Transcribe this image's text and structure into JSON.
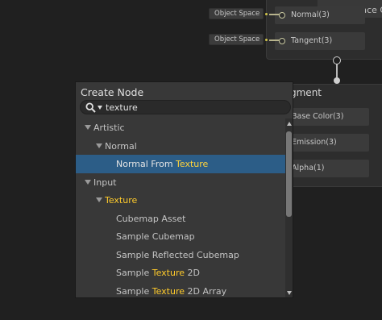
{
  "graph": {
    "master_node": {
      "title": "Surface O",
      "ports": [
        {
          "label": "Normal(3)",
          "input": "Object Space"
        },
        {
          "label": "Tangent(3)",
          "input": "Object Space"
        }
      ]
    },
    "fragment": {
      "title": "gment",
      "ports": [
        "Base Color(3)",
        "Emission(3)",
        "Alpha(1)"
      ]
    }
  },
  "create_node": {
    "title": "Create Node",
    "search": {
      "value": "texture",
      "query_highlight": "Texture"
    },
    "items": [
      {
        "label": "Artistic",
        "type": "category",
        "level": 0,
        "expanded": true
      },
      {
        "label": "Normal",
        "type": "category",
        "level": 1,
        "expanded": true
      },
      {
        "pre": "Normal From ",
        "match": "Texture",
        "post": "",
        "type": "node",
        "level": 2,
        "selected": true
      },
      {
        "label": "Input",
        "type": "category",
        "level": 0,
        "expanded": true
      },
      {
        "pre": "",
        "match": "Texture",
        "post": "",
        "type": "category",
        "level": 1,
        "expanded": true
      },
      {
        "pre": "Cubemap Asset",
        "match": "",
        "post": "",
        "type": "node",
        "level": 2
      },
      {
        "pre": "Sample Cubemap",
        "match": "",
        "post": "",
        "type": "node",
        "level": 2
      },
      {
        "pre": "Sample Reflected Cubemap",
        "match": "",
        "post": "",
        "type": "node",
        "level": 2
      },
      {
        "pre": "Sample ",
        "match": "Texture",
        "post": " 2D",
        "type": "node",
        "level": 2
      },
      {
        "pre": "Sample ",
        "match": "Texture",
        "post": " 2D Array",
        "type": "node",
        "level": 2
      }
    ]
  },
  "colors": {
    "background": "#202020",
    "popup": "#383838",
    "selected_row": "#2c5d87",
    "match_highlight": "#ffcb2b"
  },
  "icons": [
    "search-icon",
    "dropdown-caret-icon",
    "expand-arrow-icon",
    "scroll-up-arrow-icon",
    "scroll-down-arrow-icon"
  ]
}
